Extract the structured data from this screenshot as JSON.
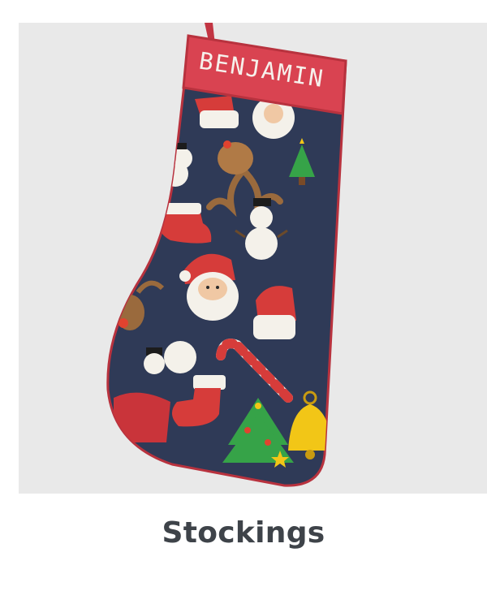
{
  "product": {
    "personalized_name": "BENJAMIN",
    "category_label": "Stockings"
  },
  "colors": {
    "background": "#e9e9e9",
    "stocking_body": "#2f3a57",
    "cuff": "#d94351",
    "trim": "#b8323e",
    "caption_text": "#3e4349"
  },
  "icons": [
    "santa-icon",
    "reindeer-icon",
    "snowman-icon",
    "candy-cane-icon",
    "christmas-tree-icon",
    "bell-icon",
    "mini-stocking-icon"
  ]
}
